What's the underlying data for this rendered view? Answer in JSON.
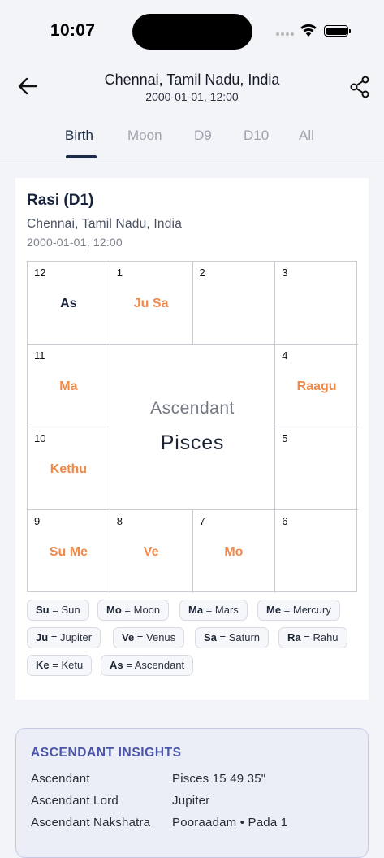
{
  "status": {
    "time": "10:07"
  },
  "header": {
    "title": "Chennai, Tamil Nadu, India",
    "subtitle": "2000-01-01, 12:00",
    "back_icon": "arrow-left-icon",
    "share_icon": "share-icon"
  },
  "tabs": [
    {
      "label": "Birth",
      "active": true
    },
    {
      "label": "Moon",
      "active": false
    },
    {
      "label": "D9",
      "active": false
    },
    {
      "label": "D10",
      "active": false
    },
    {
      "label": "All",
      "active": false
    }
  ],
  "card": {
    "title": "Rasi (D1)",
    "place": "Chennai, Tamil Nadu, India",
    "datetime": "2000-01-01, 12:00"
  },
  "chart": {
    "center_label": "Ascendant",
    "center_sign": "Pisces",
    "planet_color": "#f08a4b",
    "ascendant_color": "#17233a",
    "houses": [
      {
        "num": "12",
        "planets": "As"
      },
      {
        "num": "1",
        "planets": "Ju Sa"
      },
      {
        "num": "2",
        "planets": ""
      },
      {
        "num": "3",
        "planets": ""
      },
      {
        "num": "11",
        "planets": "Ma"
      },
      {
        "num": "4",
        "planets": "Raagu"
      },
      {
        "num": "10",
        "planets": "Kethu"
      },
      {
        "num": "5",
        "planets": ""
      },
      {
        "num": "9",
        "planets": "Su Me"
      },
      {
        "num": "8",
        "planets": "Ve"
      },
      {
        "num": "7",
        "planets": "Mo"
      },
      {
        "num": "6",
        "planets": ""
      }
    ]
  },
  "legend": [
    {
      "abbr": "Su",
      "name": "Sun"
    },
    {
      "abbr": "Mo",
      "name": "Moon"
    },
    {
      "abbr": "Ma",
      "name": "Mars"
    },
    {
      "abbr": "Me",
      "name": "Mercury"
    },
    {
      "abbr": "Ju",
      "name": "Jupiter"
    },
    {
      "abbr": "Ve",
      "name": "Venus"
    },
    {
      "abbr": "Sa",
      "name": "Saturn"
    },
    {
      "abbr": "Ra",
      "name": "Rahu"
    },
    {
      "abbr": "Ke",
      "name": "Ketu"
    },
    {
      "abbr": "As",
      "name": "Ascendant"
    }
  ],
  "insights": {
    "title": "ASCENDANT INSIGHTS",
    "rows": [
      {
        "key": "Ascendant",
        "value": "Pisces 15 49 35\""
      },
      {
        "key": "Ascendant Lord",
        "value": "Jupiter"
      },
      {
        "key": "Ascendant Nakshatra",
        "value": "Pooraadam • Pada 1"
      }
    ]
  }
}
